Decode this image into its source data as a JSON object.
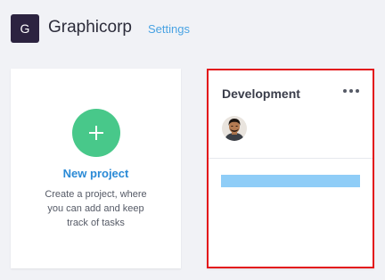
{
  "header": {
    "org_initial": "G",
    "org_name": "Graphicorp",
    "settings_label": "Settings"
  },
  "new_project_card": {
    "icon": "plus-icon",
    "label": "New project",
    "description": "Create a project, where you can add and keep track of tasks"
  },
  "project_card": {
    "title": "Development",
    "menu_icon": "more-horizontal-icon",
    "members": [
      {
        "avatar": "person-avatar"
      }
    ],
    "progress": 1.0
  },
  "colors": {
    "background": "#f1f2f6",
    "logo_bg": "#2c2340",
    "accent_link": "#4aa3e3",
    "add_button": "#48c88a",
    "new_project_label": "#2a8ad6",
    "highlight_border": "#e3161a",
    "progress_fill": "#8fcdf7"
  }
}
